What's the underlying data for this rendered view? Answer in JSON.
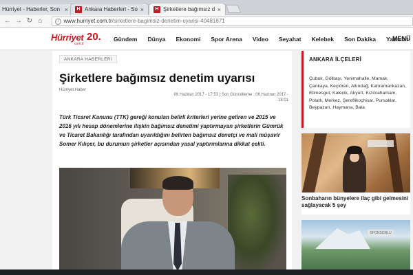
{
  "browser": {
    "tabs": [
      {
        "label": "Hürriyet - Haberler, Son D",
        "close": "×"
      },
      {
        "label": "Ankara Haberleri - Son D",
        "favicon": "H",
        "close": "×"
      },
      {
        "label": "Şirketlere bağımsız denetim",
        "favicon": "H",
        "close": "×",
        "active": true
      }
    ],
    "url_host": "www.hurriyet.com.tr",
    "url_path": "/sirketlere-bagimsiz-denetim-uyarisi-40481871",
    "nav_icons": [
      "back-arrow-icon",
      "forward-arrow-icon",
      "reload-icon",
      "home-icon"
    ]
  },
  "site": {
    "logo_text": "Hürriyet",
    "logo_sub": "com.tr",
    "logo_anniv": "20.",
    "nav": [
      "Gündem",
      "Dünya",
      "Ekonomi",
      "Spor Arena",
      "Video",
      "Seyahat",
      "Kelebek",
      "Son Dakika",
      "Yazarlar"
    ],
    "menu_label": "MENÜ"
  },
  "article": {
    "category": "ANKARA HABERLERİ",
    "headline": "Şirketlere bağımsız denetim uyarısı",
    "source": "Hürriyet Haber",
    "date_published": "06 Haziran 2017 - 17:53",
    "date_updated_label": "Son Güncelleme : 06 Haziran 2017 - 18:01",
    "spot": "Türk Ticaret Kanunu (TTK) gereği konulan belirli kriterleri yerine getiren ve 2015 ve 2016 yılı hesap dönemlerine ilişkin bağımsız denetimi yaptırmayan şirketlerin Gümrük ve Ticaret Bakanlığı tarafından uyarıldığını belirten bağımsız denetçi ve mali müşavir Somer Kılıçer, bu durumun şirketler açısından yasal yaptırımlarına dikkat çekti."
  },
  "sidebar": {
    "ilceler_title": "ANKARA İLÇELERİ",
    "ilceler_list": "Çubuk, Gölbaşı, Yenimahalle, Mamak, Çankaya, Keçiören, Altındağ, Kahramankazan, Etimesgut, Kalecik, Akyurt, Kızılcahamam, Polatlı, Merkez, Şereflikoçhisar, Pursaklar, Beypazarı, Haymana, Bala",
    "card1_caption": "Sonbaharın bünyelere ilaç gibi gelmesini sağlayacak 5 şey",
    "card2_badge": "SPONSORLU"
  }
}
